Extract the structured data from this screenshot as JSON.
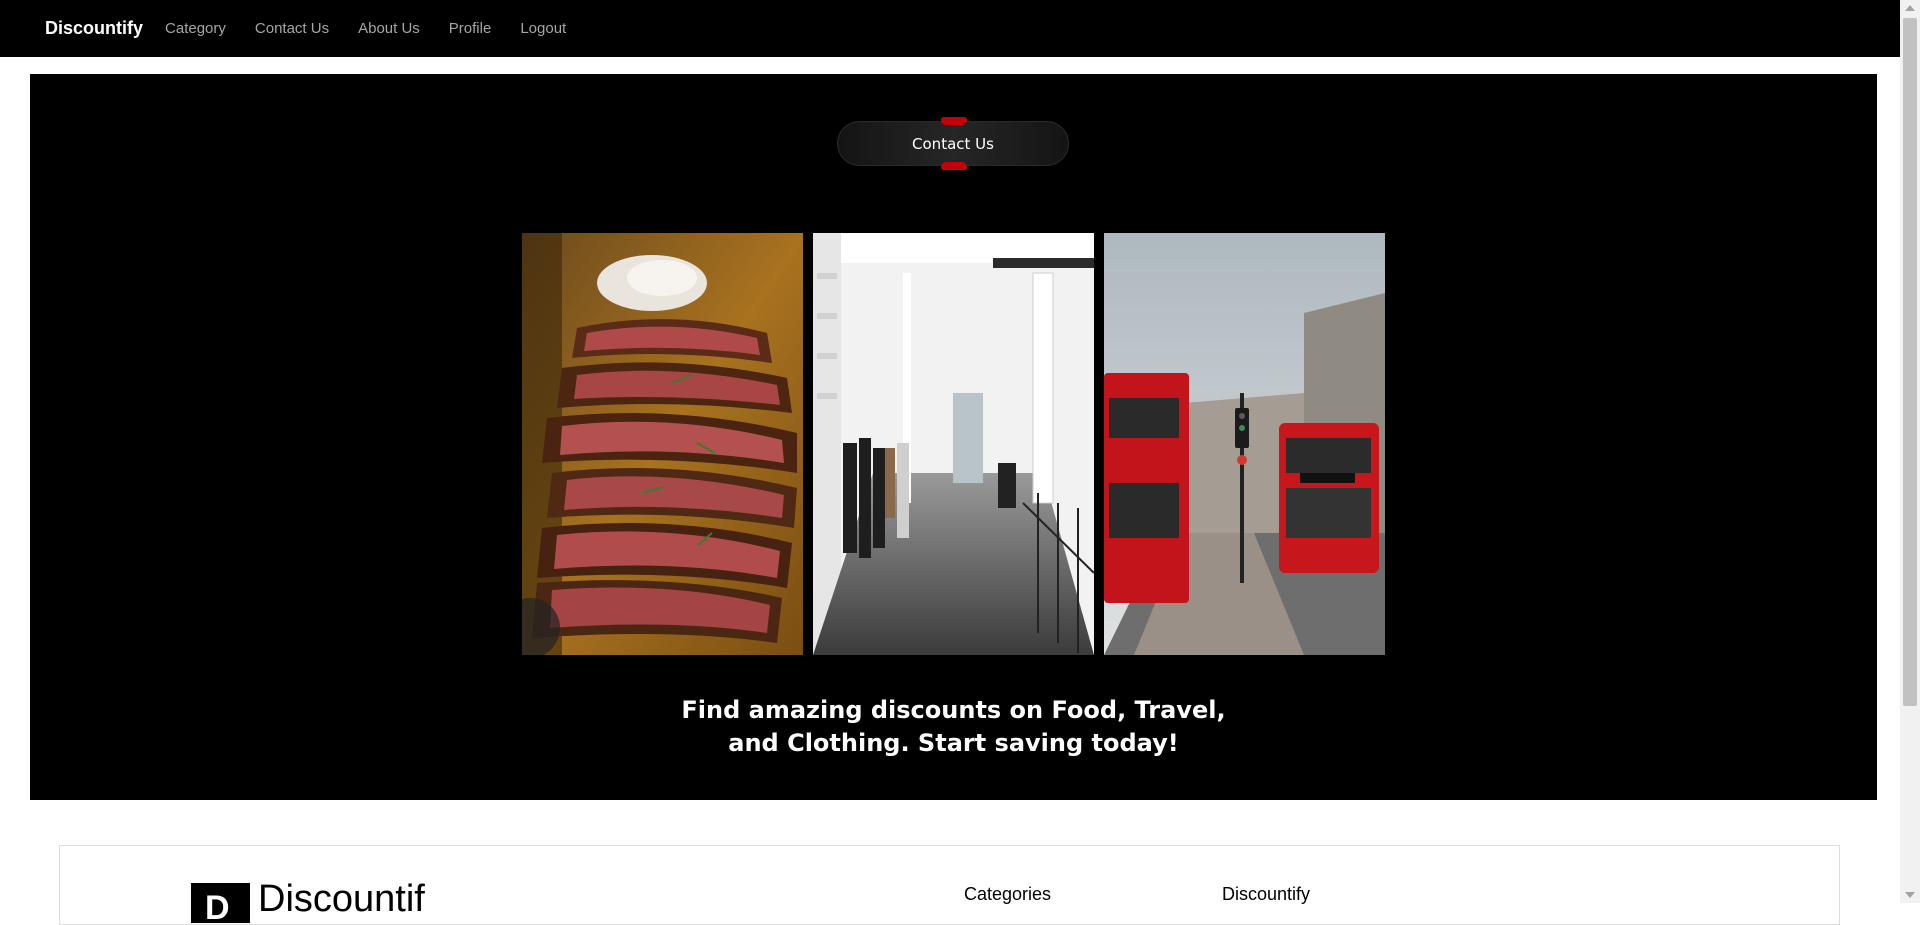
{
  "navbar": {
    "brand": "Discountify",
    "links": [
      "Category",
      "Contact Us",
      "About Us",
      "Profile",
      "Logout"
    ]
  },
  "hero": {
    "contact_button": "Contact Us",
    "accent_color": "#c4000b",
    "images": [
      "sliced steak on wooden board",
      "clothing store interior with racks",
      "red double-decker buses on city street"
    ],
    "tagline_line1": "Find amazing discounts on Food, Travel,",
    "tagline_line2": "and Clothing. Start saving today!"
  },
  "footer": {
    "logo_letter": "D",
    "logo_text": "Discountif",
    "col_categories": "Categories",
    "col_brand": "Discountify"
  }
}
